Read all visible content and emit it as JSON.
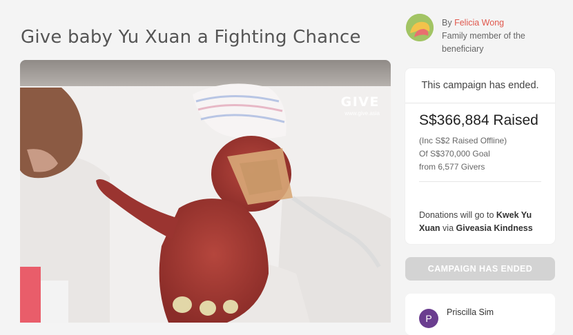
{
  "campaign": {
    "title": "Give baby Yu Xuan a Fighting Chance"
  },
  "watermark": {
    "logo": "GIVE",
    "url": "www.give.asia"
  },
  "author": {
    "by_prefix": "By",
    "name": "Felicia Wong",
    "relation_line1": "Family member of the",
    "relation_line2": "beneficiary"
  },
  "status_card": {
    "ended_text": "This campaign has ended.",
    "raised": "S$366,884 Raised",
    "offline": "(Inc S$2 Raised Offline)",
    "goal": "Of S$370,000 Goal",
    "givers": "from 6,577 Givers",
    "donate_prefix": "Donations will go to",
    "beneficiary": "Kwek Yu Xuan",
    "via": "via",
    "platform": "Giveasia Kindness"
  },
  "ended_button": {
    "label": "CAMPAIGN HAS ENDED"
  },
  "giver": {
    "initial": "P",
    "name": "Priscilla Sim"
  },
  "colors": {
    "accent": "#e0584d",
    "page_bg": "#f4f4f4",
    "button_disabled": "#d3d3d3",
    "giver_avatar": "#6a3d8f"
  }
}
